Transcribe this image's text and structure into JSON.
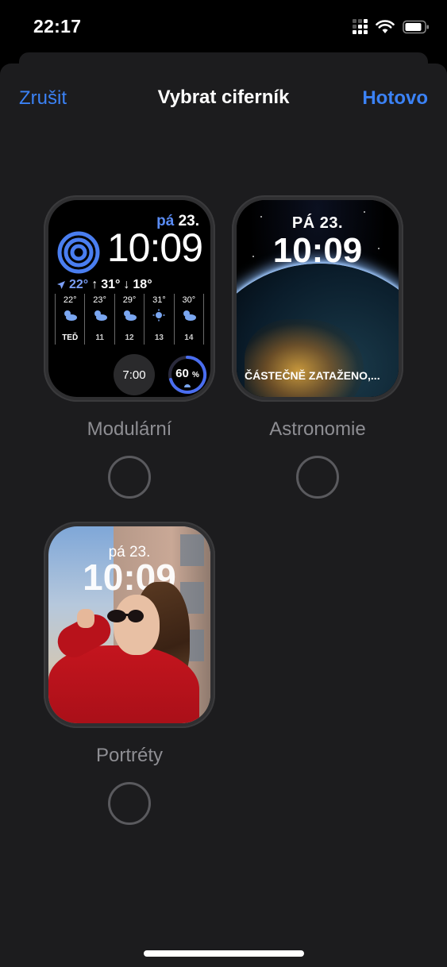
{
  "status_bar": {
    "time": "22:17"
  },
  "nav": {
    "cancel": "Zrušit",
    "title": "Vybrat ciferník",
    "done": "Hotovo"
  },
  "faces": [
    {
      "label": "Modulární",
      "date": {
        "day": "pá",
        "num": "23."
      },
      "time": "10:09",
      "temps": {
        "current": "22°",
        "high": "31°",
        "low": "18°"
      },
      "forecast": [
        {
          "temp": "22°",
          "icon": "partly-cloudy-icon",
          "label": "TEĎ"
        },
        {
          "temp": "23°",
          "icon": "partly-cloudy-icon",
          "label": "11"
        },
        {
          "temp": "29°",
          "icon": "partly-cloudy-icon",
          "label": "12"
        },
        {
          "temp": "31°",
          "icon": "sun-icon",
          "label": "13"
        },
        {
          "temp": "30°",
          "icon": "partly-cloudy-icon",
          "label": "14"
        }
      ],
      "alarm": "7:00",
      "rain_chance": "60",
      "rain_unit": "%"
    },
    {
      "label": "Astronomie",
      "date": "PÁ 23.",
      "time": "10:09",
      "weather": "ČÁSTEČNĚ ZATAŽENO,..."
    },
    {
      "label": "Portréty",
      "date": "pá 23.",
      "time": "10:09"
    }
  ],
  "colors": {
    "accent": "#3b82f6",
    "sheet": "#1c1c1e",
    "label": "#8e8e93"
  }
}
